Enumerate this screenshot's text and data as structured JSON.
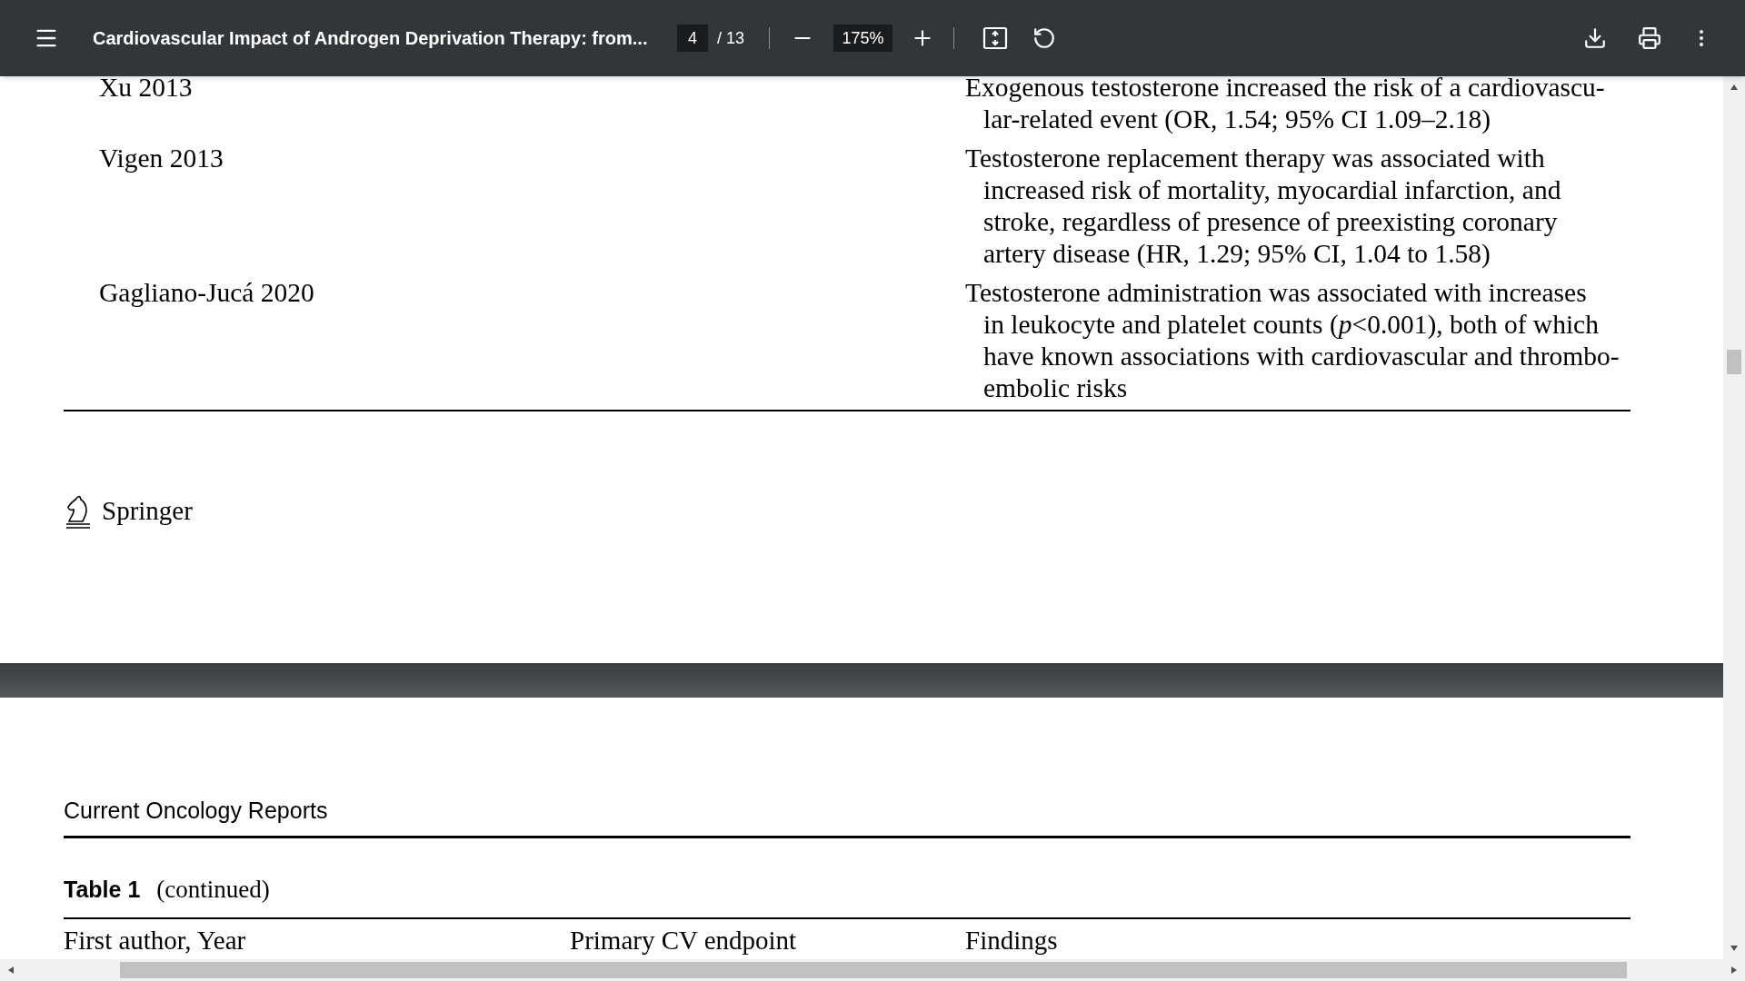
{
  "toolbar": {
    "title": "Cardiovascular Impact of Androgen Deprivation Therapy: from...",
    "page_current": "4",
    "page_total": "/ 13",
    "zoom": "175%"
  },
  "table_rows": [
    {
      "author": "Xu 2013",
      "finding_lines": [
        "Exogenous testosterone increased the risk of a cardiovascu-",
        "lar-related event (OR, 1.54; 95% CI 1.09–2.18)"
      ]
    },
    {
      "author": "Vigen 2013",
      "finding_lines": [
        "Testosterone replacement therapy was associated with",
        "increased risk of mortality, myocardial infarction, and",
        "stroke, regardless of presence of preexisting coronary",
        "artery disease (HR, 1.29; 95% CI, 1.04 to 1.58)"
      ]
    },
    {
      "author": "Gagliano-Jucá 2020",
      "finding_lines": [
        "Testosterone administration was associated with increases",
        "in leukocyte and platelet counts (*p*<0.001), both of which",
        "have known associations with cardiovascular and thrombo-",
        "embolic risks"
      ]
    }
  ],
  "publisher": "Springer",
  "next_page": {
    "journal": "Current Oncology Reports",
    "caption_label": "Table 1",
    "caption_text": "(continued)",
    "columns": [
      "First author, Year",
      "Primary CV endpoint",
      "Findings"
    ]
  }
}
